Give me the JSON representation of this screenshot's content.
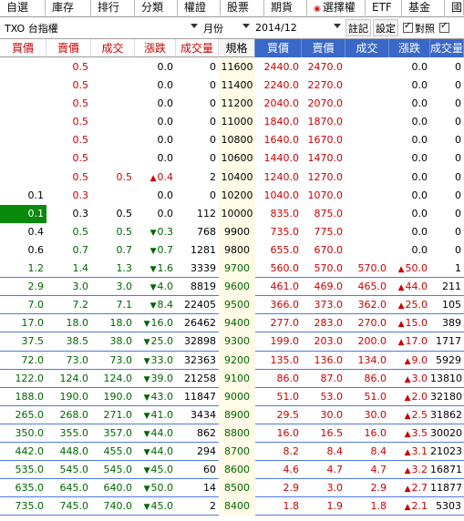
{
  "tabs": [
    "自選",
    "庫存",
    "排行",
    "分類",
    "權證",
    "股票",
    "期貨",
    "選擇權",
    "ETF",
    "基金",
    "國"
  ],
  "selector": {
    "product": "TXO 台指權",
    "period": "月份",
    "month": "2014/12",
    "note_btn": "註記",
    "settings_btn": "設定",
    "compare_label": "對照"
  },
  "headers": [
    "買價",
    "賣價",
    "成交",
    "漲跌",
    "成交量",
    "規格",
    "買價",
    "賣價",
    "成交",
    "漲跌",
    "成交量"
  ],
  "rows": [
    [
      "",
      "0.5",
      "",
      "0.0",
      "0",
      "11600",
      "2440.0",
      "2470.0",
      "",
      "0.0",
      "0"
    ],
    [
      "",
      "0.5",
      "",
      "0.0",
      "0",
      "11400",
      "2240.0",
      "2270.0",
      "",
      "0.0",
      "0"
    ],
    [
      "",
      "0.5",
      "",
      "0.0",
      "0",
      "11200",
      "2040.0",
      "2070.0",
      "",
      "0.0",
      "0"
    ],
    [
      "",
      "0.5",
      "",
      "0.0",
      "0",
      "11000",
      "1840.0",
      "1870.0",
      "",
      "0.0",
      "0"
    ],
    [
      "",
      "0.5",
      "",
      "0.0",
      "0",
      "10800",
      "1640.0",
      "1670.0",
      "",
      "0.0",
      "0"
    ],
    [
      "",
      "0.5",
      "",
      "0.0",
      "0",
      "10600",
      "1440.0",
      "1470.0",
      "",
      "0.0",
      "0"
    ],
    [
      "",
      "0.5",
      "0.5",
      "0.4",
      "2",
      "10400",
      "1240.0",
      "1270.0",
      "",
      "0.0",
      "0"
    ],
    [
      "0.1",
      "0.3",
      "",
      "0.0",
      "0",
      "10200",
      "1040.0",
      "1070.0",
      "",
      "0.0",
      "0"
    ],
    [
      "0.1",
      "0.3",
      "0.5",
      "0.0",
      "112",
      "10000",
      "835.0",
      "875.0",
      "",
      "0.0",
      "0"
    ],
    [
      "0.4",
      "0.5",
      "0.5",
      "0.3",
      "768",
      "9900",
      "735.0",
      "775.0",
      "",
      "0.0",
      "0"
    ],
    [
      "0.6",
      "0.7",
      "0.7",
      "0.7",
      "1281",
      "9800",
      "655.0",
      "670.0",
      "",
      "0.0",
      "0"
    ],
    [
      "1.2",
      "1.4",
      "1.3",
      "1.6",
      "3339",
      "9700",
      "560.0",
      "570.0",
      "570.0",
      "50.0",
      "1"
    ],
    [
      "2.9",
      "3.0",
      "3.0",
      "4.0",
      "8819",
      "9600",
      "461.0",
      "469.0",
      "465.0",
      "44.0",
      "211"
    ],
    [
      "7.0",
      "7.2",
      "7.1",
      "8.4",
      "22405",
      "9500",
      "366.0",
      "373.0",
      "362.0",
      "25.0",
      "105"
    ],
    [
      "17.0",
      "18.0",
      "18.0",
      "16.0",
      "26462",
      "9400",
      "277.0",
      "283.0",
      "270.0",
      "15.0",
      "389"
    ],
    [
      "37.5",
      "38.5",
      "38.0",
      "25.0",
      "32898",
      "9300",
      "199.0",
      "203.0",
      "200.0",
      "17.0",
      "1717"
    ],
    [
      "72.0",
      "73.0",
      "73.0",
      "33.0",
      "32363",
      "9200",
      "135.0",
      "136.0",
      "134.0",
      "9.0",
      "5929"
    ],
    [
      "122.0",
      "124.0",
      "124.0",
      "39.0",
      "21258",
      "9100",
      "86.0",
      "87.0",
      "86.0",
      "3.0",
      "13810"
    ],
    [
      "188.0",
      "190.0",
      "190.0",
      "43.0",
      "11847",
      "9000",
      "51.0",
      "53.0",
      "51.0",
      "2.0",
      "32180"
    ],
    [
      "265.0",
      "268.0",
      "271.0",
      "41.0",
      "3434",
      "8900",
      "29.5",
      "30.0",
      "30.0",
      "2.5",
      "31862"
    ],
    [
      "350.0",
      "355.0",
      "357.0",
      "44.0",
      "862",
      "8800",
      "16.0",
      "16.5",
      "16.0",
      "3.5",
      "30020"
    ],
    [
      "442.0",
      "448.0",
      "455.0",
      "44.0",
      "294",
      "8700",
      "8.2",
      "8.4",
      "8.4",
      "3.1",
      "21023"
    ],
    [
      "535.0",
      "545.0",
      "545.0",
      "45.0",
      "60",
      "8600",
      "4.6",
      "4.7",
      "4.7",
      "3.2",
      "16871"
    ],
    [
      "635.0",
      "645.0",
      "640.0",
      "50.0",
      "14",
      "8500",
      "2.9",
      "3.0",
      "2.9",
      "2.7",
      "11877"
    ],
    [
      "735.0",
      "745.0",
      "740.0",
      "45.0",
      "2",
      "8400",
      "1.8",
      "1.9",
      "1.8",
      "2.1",
      "5303"
    ]
  ],
  "colors": {
    "header_blue": "#4e6fb8",
    "up_red": "#cc0000",
    "down_green": "#006600",
    "highlight_green": "#0a8a0a",
    "strike_bg": "#fffbe6"
  }
}
